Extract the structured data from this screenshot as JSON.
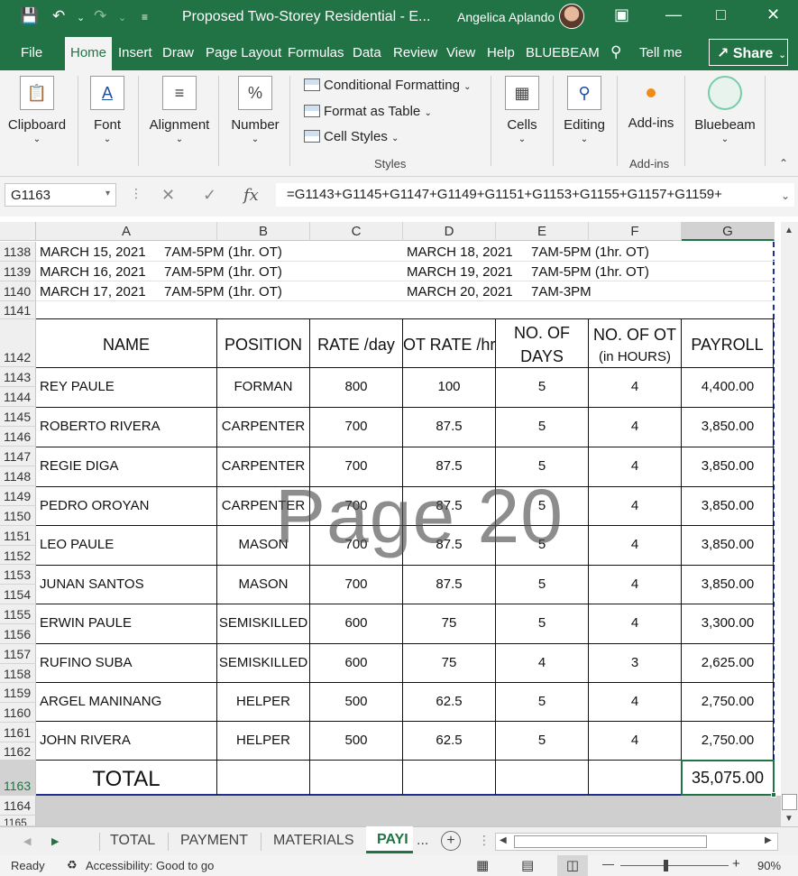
{
  "window": {
    "title": "Proposed Two-Storey Residential  -  E...",
    "user": "Angelica Aplando"
  },
  "menu": {
    "tabs": [
      "File",
      "Home",
      "Insert",
      "Draw",
      "Page Layout",
      "Formulas",
      "Data",
      "Review",
      "View",
      "Help",
      "BLUEBEAM"
    ],
    "tell_me": "Tell me",
    "share": "Share"
  },
  "ribbon": {
    "clipboard": "Clipboard",
    "font": "Font",
    "alignment": "Alignment",
    "number": "Number",
    "conditional_formatting": "Conditional Formatting",
    "format_as_table": "Format as Table",
    "cell_styles": "Cell Styles",
    "styles_label": "Styles",
    "cells": "Cells",
    "editing": "Editing",
    "addins": "Add-ins",
    "addins_group": "Add-ins",
    "bluebeam": "Bluebeam"
  },
  "formula_bar": {
    "name_box": "G1163",
    "formula": "=G1143+G1145+G1147+G1149+G1151+G1153+G1155+G1157+G1159+"
  },
  "columns": [
    "A",
    "B",
    "C",
    "D",
    "E",
    "F",
    "G"
  ],
  "rows": [
    "1138",
    "1139",
    "1140",
    "1141",
    "1142",
    "1143",
    "1144",
    "1145",
    "1146",
    "1147",
    "1148",
    "1149",
    "1150",
    "1151",
    "1152",
    "1153",
    "1154",
    "1155",
    "1156",
    "1157",
    "1158",
    "1159",
    "1160",
    "1161",
    "1162",
    "1163",
    "1164",
    "1165"
  ],
  "schedule": {
    "r1138a": "MARCH 15, 2021",
    "r1138b": "7AM-5PM (1hr. OT)",
    "r1138d": "MARCH 18, 2021",
    "r1138e": "7AM-5PM (1hr. OT)",
    "r1139a": "MARCH 16, 2021",
    "r1139b": "7AM-5PM (1hr. OT)",
    "r1139d": "MARCH 19, 2021",
    "r1139e": "7AM-5PM (1hr. OT)",
    "r1140a": "MARCH 17, 2021",
    "r1140b": "7AM-5PM (1hr. OT)",
    "r1140d": "MARCH 20, 2021",
    "r1140e": "7AM-3PM"
  },
  "table_headers": {
    "name": "NAME",
    "position": "POSITION",
    "rate": "RATE /day",
    "ot_rate": "OT RATE /hr",
    "days_1": "NO. OF",
    "days_2": "DAYS",
    "ot_1": "NO. OF OT",
    "ot_2": "(in HOURS)",
    "payroll": "PAYROLL"
  },
  "employees": [
    {
      "name": "REY PAULE",
      "position": "FORMAN",
      "rate": "800",
      "ot_rate": "100",
      "days": "5",
      "ot_hours": "4",
      "payroll": "4,400.00"
    },
    {
      "name": "ROBERTO RIVERA",
      "position": "CARPENTER",
      "rate": "700",
      "ot_rate": "87.5",
      "days": "5",
      "ot_hours": "4",
      "payroll": "3,850.00"
    },
    {
      "name": "REGIE DIGA",
      "position": "CARPENTER",
      "rate": "700",
      "ot_rate": "87.5",
      "days": "5",
      "ot_hours": "4",
      "payroll": "3,850.00"
    },
    {
      "name": "PEDRO OROYAN",
      "position": "CARPENTER",
      "rate": "700",
      "ot_rate": "87.5",
      "days": "5",
      "ot_hours": "4",
      "payroll": "3,850.00"
    },
    {
      "name": "LEO PAULE",
      "position": "MASON",
      "rate": "700",
      "ot_rate": "87.5",
      "days": "5",
      "ot_hours": "4",
      "payroll": "3,850.00"
    },
    {
      "name": "JUNAN SANTOS",
      "position": "MASON",
      "rate": "700",
      "ot_rate": "87.5",
      "days": "5",
      "ot_hours": "4",
      "payroll": "3,850.00"
    },
    {
      "name": "ERWIN PAULE",
      "position": "SEMISKILLED",
      "rate": "600",
      "ot_rate": "75",
      "days": "5",
      "ot_hours": "4",
      "payroll": "3,300.00"
    },
    {
      "name": "RUFINO SUBA",
      "position": "SEMISKILLED",
      "rate": "600",
      "ot_rate": "75",
      "days": "4",
      "ot_hours": "3",
      "payroll": "2,625.00"
    },
    {
      "name": "ARGEL MANINANG",
      "position": "HELPER",
      "rate": "500",
      "ot_rate": "62.5",
      "days": "5",
      "ot_hours": "4",
      "payroll": "2,750.00"
    },
    {
      "name": "JOHN RIVERA",
      "position": "HELPER",
      "rate": "500",
      "ot_rate": "62.5",
      "days": "5",
      "ot_hours": "4",
      "payroll": "2,750.00"
    }
  ],
  "total": {
    "label": "TOTAL",
    "value": "35,075.00"
  },
  "watermark": "Page 20",
  "sheet_tabs": [
    "TOTAL",
    "PAYMENT",
    "MATERIALS",
    "PAYI",
    "..."
  ],
  "status": {
    "ready": "Ready",
    "accessibility": "Accessibility: Good to go",
    "zoom": "90%"
  }
}
